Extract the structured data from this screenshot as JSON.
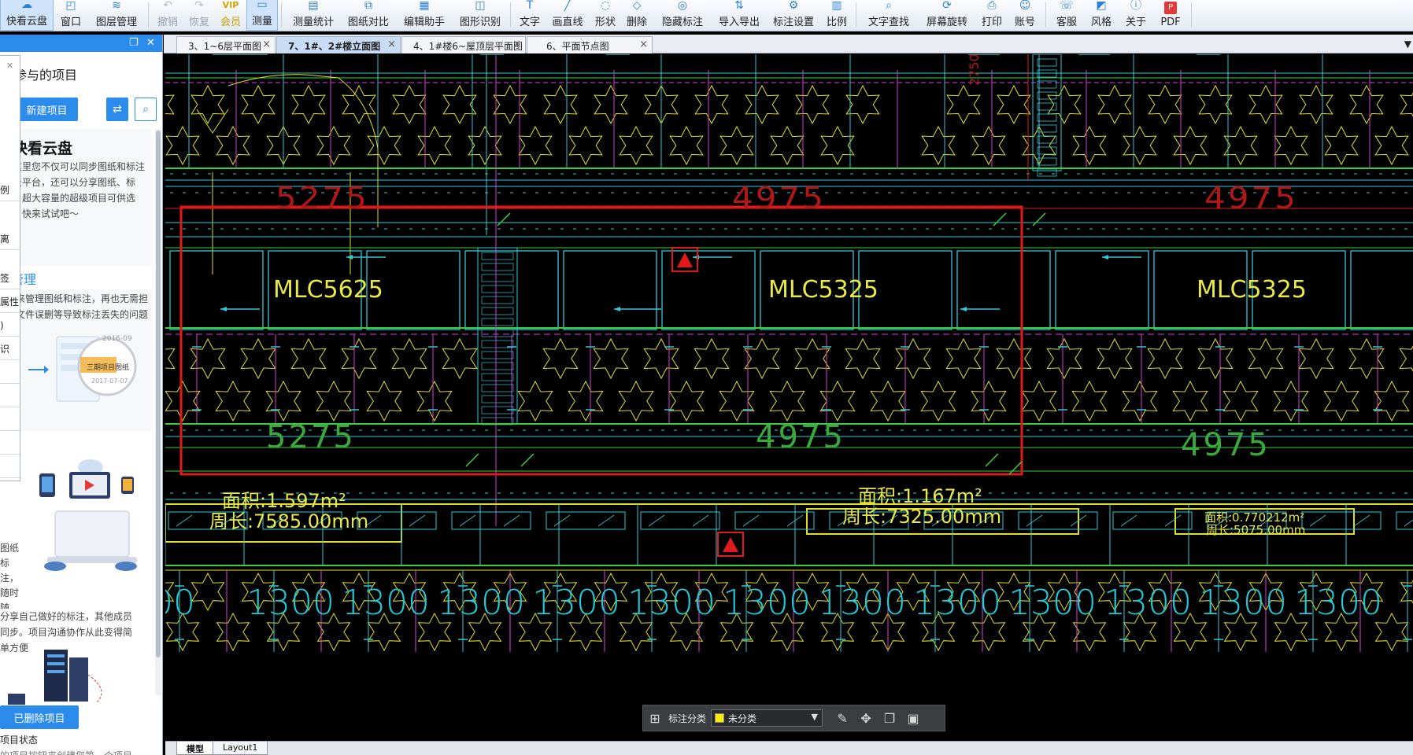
{
  "toolbar": {
    "items": [
      {
        "label": "快看云盘",
        "icon": "cloud-icon"
      },
      {
        "label": "窗口",
        "icon": "window-icon"
      },
      {
        "label": "图层管理",
        "icon": "layers-icon"
      },
      {
        "label": "撤销",
        "icon": "undo-icon"
      },
      {
        "label": "恢复",
        "icon": "redo-icon"
      },
      {
        "label": "会员",
        "icon": "vip-icon"
      },
      {
        "label": "测量",
        "icon": "measure-icon"
      },
      {
        "label": "测量统计",
        "icon": "measure-stats-icon"
      },
      {
        "label": "图纸对比",
        "icon": "compare-icon"
      },
      {
        "label": "编辑助手",
        "icon": "edit-assistant-icon"
      },
      {
        "label": "图形识别",
        "icon": "shape-recognition-icon"
      },
      {
        "label": "文字",
        "icon": "text-icon"
      },
      {
        "label": "画直线",
        "icon": "line-icon"
      },
      {
        "label": "形状",
        "icon": "shape-icon"
      },
      {
        "label": "删除",
        "icon": "eraser-icon"
      },
      {
        "label": "隐藏标注",
        "icon": "hide-annotation-icon"
      },
      {
        "label": "导入导出",
        "icon": "import-export-icon"
      },
      {
        "label": "标注设置",
        "icon": "annotation-settings-icon"
      },
      {
        "label": "比例",
        "icon": "scale-icon"
      },
      {
        "label": "文字查找",
        "icon": "text-search-icon"
      },
      {
        "label": "屏幕旋转",
        "icon": "rotate-screen-icon"
      },
      {
        "label": "打印",
        "icon": "print-icon"
      },
      {
        "label": "账号",
        "icon": "account-icon"
      },
      {
        "label": "客服",
        "icon": "support-icon"
      },
      {
        "label": "风格",
        "icon": "style-icon"
      },
      {
        "label": "关于",
        "icon": "about-icon"
      },
      {
        "label": "PDF",
        "icon": "pdf-icon"
      }
    ],
    "vip_glyph": "VIP",
    "pdf_glyph": "P"
  },
  "tabs": [
    {
      "label": "3、1~6层平面图"
    },
    {
      "label": "7、1#、2#楼立面图",
      "active": true
    },
    {
      "label": "4、1#楼6~屋顶层平面图"
    },
    {
      "label": "6、平面节点图"
    }
  ],
  "tab_close": "×",
  "tab_more": "▼",
  "left_panel": {
    "title": "参与的项目",
    "new_project": "新建项目",
    "section1_title": "快看云盘",
    "section1_text": "在这里您不仅可以同步图纸和标注到云平台，还可以分享图纸、标注，超大容量的超级项目可供选择！快来试试吧～",
    "section2_title": "管理",
    "section2_text": "用来管理图纸和标注，再也无需担心文件误删等导致标注丢失的问题",
    "promo_label": "三期项目图纸",
    "promo_dates": [
      "2016-09",
      "2017-07-07"
    ],
    "section3_text": "图纸标注，随时随地，",
    "section4_text": "分享自己做好的标注，其他成员同步。项目沟通协作从此变得简单方便",
    "deleted_btn": "已删除项目",
    "footer1": "项目状态",
    "footer2": "的项目按钮来创建您第一个项目"
  },
  "side_strip": [
    "例",
    "离",
    "签",
    "属性",
    ")",
    "识"
  ],
  "drawing": {
    "dims_red": [
      "5275",
      "4975",
      "4975"
    ],
    "dims_green": [
      "5275",
      "4975",
      "4975"
    ],
    "labels": [
      "MLC5625",
      "MLC5325",
      "MLC5325"
    ],
    "area1": "面积:1.597m²",
    "perim1": "周长:7585.00mm",
    "area2": "面积:1.167m²",
    "perim2": "周长:7325.00mm",
    "area3": "面积:0.770212m²",
    "perim3": "周长:5075.00mm",
    "bottom_dims": [
      "00",
      "1300",
      "1300",
      "1300",
      "1300",
      "1300",
      "1300",
      "1300",
      "1300",
      "1300",
      "1300",
      "1300",
      "1300"
    ],
    "vertical_dim": "2750"
  },
  "annotation_bar": {
    "label": "标注分类",
    "value": "未分类",
    "swatch_color": "#ffee00"
  },
  "layouts": [
    {
      "label": "模型",
      "active": true
    },
    {
      "label": "Layout1"
    }
  ]
}
